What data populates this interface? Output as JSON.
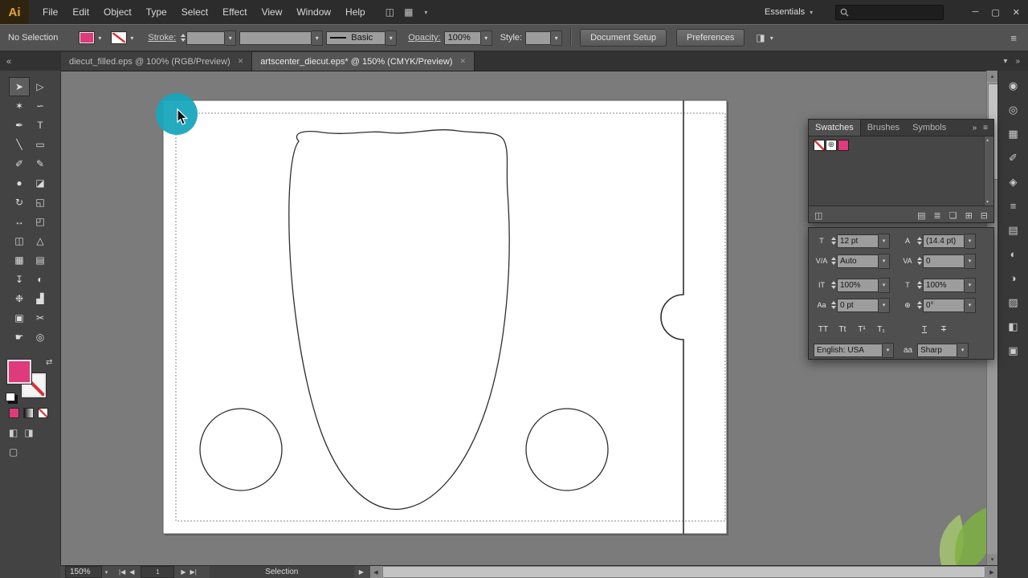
{
  "colors": {
    "accent_pink": "#de3a7c",
    "teal_highlight": "#18a7bd",
    "leaf_green": "#7eb242"
  },
  "menubar": {
    "logo": "Ai",
    "menus": [
      "File",
      "Edit",
      "Object",
      "Type",
      "Select",
      "Effect",
      "View",
      "Window",
      "Help"
    ],
    "bridge_icon": "◫",
    "arrange_icon": "▦",
    "workspace_label": "Essentials",
    "window_controls": {
      "minimize": "─",
      "restore": "▢",
      "close": "✕"
    }
  },
  "controlbar": {
    "selection_label": "No Selection",
    "stroke_link": "Stroke:",
    "basic_style": "Basic",
    "opacity_link": "Opacity:",
    "opacity_value": "100%",
    "style_label": "Style:",
    "document_setup_label": "Document Setup",
    "preferences_label": "Preferences",
    "align_icon": "◨",
    "menu_icon": "≡"
  },
  "tabbar": {
    "collapse_icon": "«",
    "close_icon": "✕",
    "overflow_icon": "▾",
    "dock_collapse_icon": "»",
    "tabs": [
      {
        "label": "diecut_filled.eps @ 100% (RGB/Preview)"
      },
      {
        "label": "artscenter_diecut.eps* @ 150% (CMYK/Preview)"
      }
    ]
  },
  "toolbar": {
    "swap_icon": "⇄",
    "tools": [
      {
        "name": "selection",
        "glyph": "➤"
      },
      {
        "name": "direct-selection",
        "glyph": "▷"
      },
      {
        "name": "magic-wand",
        "glyph": "✶"
      },
      {
        "name": "lasso",
        "glyph": "∽"
      },
      {
        "name": "pen",
        "glyph": "✒"
      },
      {
        "name": "type",
        "glyph": "T"
      },
      {
        "name": "line-segment",
        "glyph": "╲"
      },
      {
        "name": "rectangle",
        "glyph": "▭"
      },
      {
        "name": "paintbrush",
        "glyph": "✐"
      },
      {
        "name": "pencil",
        "glyph": "✎"
      },
      {
        "name": "blob-brush",
        "glyph": "●"
      },
      {
        "name": "eraser",
        "glyph": "◪"
      },
      {
        "name": "rotate",
        "glyph": "↻"
      },
      {
        "name": "scale",
        "glyph": "◱"
      },
      {
        "name": "width",
        "glyph": "↔"
      },
      {
        "name": "free-transform",
        "glyph": "◰"
      },
      {
        "name": "shape-builder",
        "glyph": "◫"
      },
      {
        "name": "perspective-grid",
        "glyph": "△"
      },
      {
        "name": "mesh",
        "glyph": "▦"
      },
      {
        "name": "gradient",
        "glyph": "▤"
      },
      {
        "name": "eyedropper",
        "glyph": "↧"
      },
      {
        "name": "blend",
        "glyph": "◐"
      },
      {
        "name": "symbol-sprayer",
        "glyph": "❉"
      },
      {
        "name": "column-graph",
        "glyph": "▟"
      },
      {
        "name": "artboard",
        "glyph": "▣"
      },
      {
        "name": "slice",
        "glyph": "✂"
      },
      {
        "name": "hand",
        "glyph": "☛"
      },
      {
        "name": "zoom",
        "glyph": "◎"
      }
    ],
    "modes": [
      {
        "name": "draw-normal",
        "glyph": "◧"
      },
      {
        "name": "draw-behind",
        "glyph": "◨"
      }
    ],
    "screen_mode_icon": "▢"
  },
  "dock": {
    "icons": [
      {
        "name": "color",
        "glyph": "◉"
      },
      {
        "name": "color-guide",
        "glyph": "◎"
      },
      {
        "name": "swatches",
        "glyph": "▦"
      },
      {
        "name": "brushes",
        "glyph": "✐"
      },
      {
        "name": "symbols",
        "glyph": "◈"
      },
      {
        "name": "stroke",
        "glyph": "≡"
      },
      {
        "name": "gradient",
        "glyph": "▤"
      },
      {
        "name": "transparency",
        "glyph": "◐"
      },
      {
        "name": "appearance",
        "glyph": "◑"
      },
      {
        "name": "graphic-styles",
        "glyph": "▨"
      },
      {
        "name": "layers",
        "glyph": "◧"
      },
      {
        "name": "artboards",
        "glyph": "▣"
      }
    ]
  },
  "panels": {
    "swatches": {
      "tabs": [
        "Swatches",
        "Brushes",
        "Symbols"
      ],
      "collapse_icon": "»",
      "menu_icon": "≡",
      "registration_glyph": "⊕",
      "footer_icons": [
        {
          "name": "swatch-libraries",
          "glyph": "◫"
        },
        {
          "name": "swatch-kinds",
          "glyph": "▤"
        },
        {
          "name": "swatch-options",
          "glyph": "≣"
        },
        {
          "name": "new-color-group",
          "glyph": "❏"
        },
        {
          "name": "new-swatch",
          "glyph": "⊞"
        },
        {
          "name": "delete-swatch",
          "glyph": "⊟"
        }
      ]
    },
    "character": {
      "rows": [
        {
          "icon": "T",
          "value": "12 pt"
        },
        {
          "icon": "A",
          "value": "(14.4 pt)"
        },
        {
          "icon": "V/A",
          "value": "Auto"
        },
        {
          "icon": "VA",
          "value": "0"
        },
        {
          "icon": "IT",
          "value": "100%"
        },
        {
          "icon": "T",
          "value": "100%"
        },
        {
          "icon": "Aa",
          "value": "0 pt"
        },
        {
          "icon": "⊕",
          "value": "0°"
        }
      ],
      "case_buttons": [
        "TT",
        "Tt",
        "T¹",
        "T₁",
        "T",
        "T"
      ],
      "language": "English: USA",
      "aa_label": "aa",
      "anti_alias": "Sharp"
    }
  },
  "statusbar": {
    "zoom": "150%",
    "first": "|◀",
    "prev": "◀",
    "artboard": "1",
    "next": "▶",
    "last": "▶|",
    "status": "Selection"
  }
}
